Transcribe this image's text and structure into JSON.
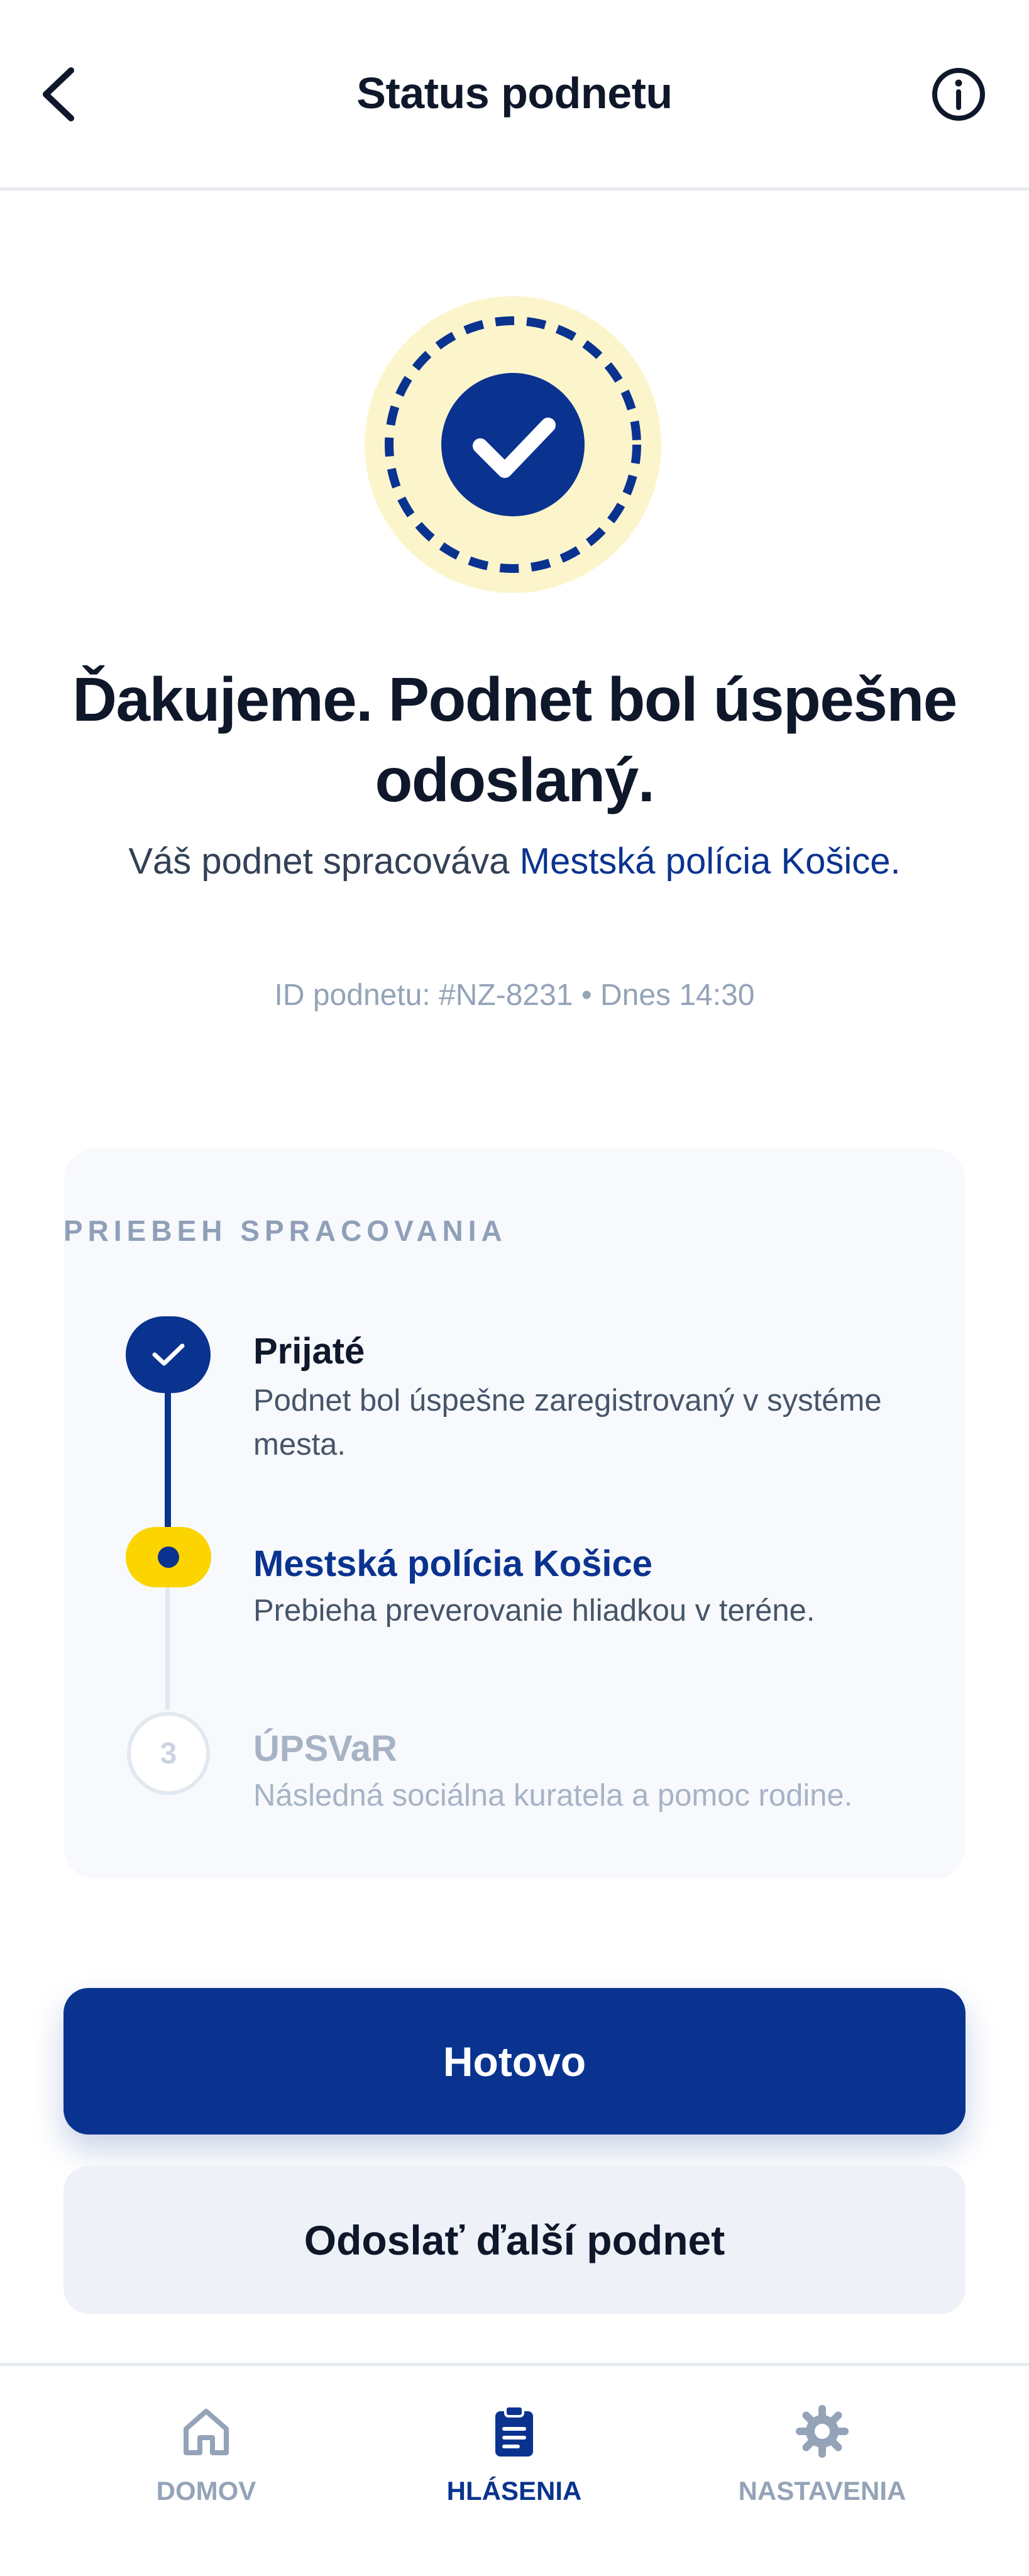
{
  "header": {
    "title": "Status podnetu"
  },
  "confirmation": {
    "headline": "Ďakujeme. Podnet bol úspešne odoslaný.",
    "subtext_prefix": "Váš podnet spracováva ",
    "handler": "Mestská polícia Košice",
    "subtext_suffix": ".",
    "meta": "ID podnetu: #NZ-8231 • Dnes 14:30"
  },
  "progress": {
    "title": "PRIEBEH SPRACOVANIA",
    "steps": [
      {
        "title": "Prijaté",
        "description": "Podnet bol úspešne zaregistrovaný v systéme mesta.",
        "status": "done"
      },
      {
        "title": "Mestská polícia Košice",
        "description": "Prebieha preverovanie hliadkou v teréne.",
        "status": "active"
      },
      {
        "number": "3",
        "title": "ÚPSVaR",
        "description": "Následná sociálna kuratela a pomoc rodine.",
        "status": "pending"
      }
    ]
  },
  "actions": {
    "primary": "Hotovo",
    "secondary": "Odoslať ďalší podnet"
  },
  "nav": {
    "items": [
      {
        "label": "DOMOV",
        "icon": "home-icon"
      },
      {
        "label": "HLÁSENIA",
        "icon": "clipboard-icon",
        "active": true
      },
      {
        "label": "NASTAVENIA",
        "icon": "gear-icon"
      }
    ]
  },
  "colors": {
    "brand": "#0a3390",
    "accent": "#fcd400",
    "badge_bg": "#fcf5cc"
  }
}
